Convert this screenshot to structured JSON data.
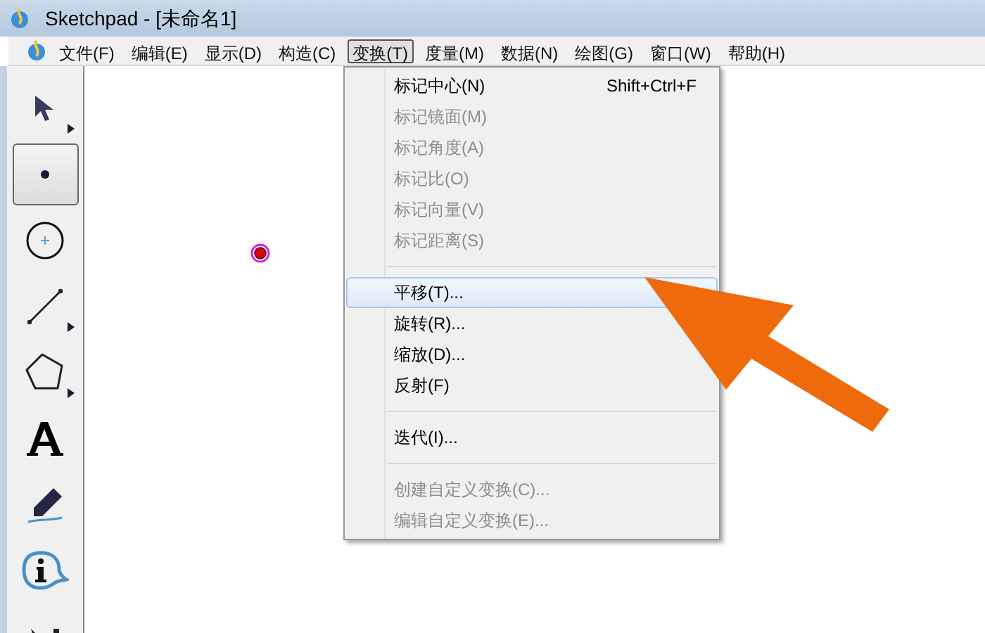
{
  "window": {
    "title": "Sketchpad  - [未命名1]"
  },
  "menubar": [
    {
      "label": "文件(F)",
      "selected": false
    },
    {
      "label": "编辑(E)",
      "selected": false
    },
    {
      "label": "显示(D)",
      "selected": false
    },
    {
      "label": "构造(C)",
      "selected": false
    },
    {
      "label": "变换(T)",
      "selected": true
    },
    {
      "label": "度量(M)",
      "selected": false
    },
    {
      "label": "数据(N)",
      "selected": false
    },
    {
      "label": "绘图(G)",
      "selected": false
    },
    {
      "label": "窗口(W)",
      "selected": false
    },
    {
      "label": "帮助(H)",
      "selected": false
    }
  ],
  "toolbox": [
    {
      "kind": "arrow",
      "selected": false,
      "submenu": true
    },
    {
      "kind": "point",
      "selected": true,
      "submenu": false
    },
    {
      "kind": "compass",
      "selected": false,
      "submenu": false
    },
    {
      "kind": "line",
      "selected": false,
      "submenu": true
    },
    {
      "kind": "polygon",
      "selected": false,
      "submenu": true
    },
    {
      "kind": "text",
      "selected": false,
      "submenu": false
    },
    {
      "kind": "marker",
      "selected": false,
      "submenu": false
    },
    {
      "kind": "info",
      "selected": false,
      "submenu": false
    },
    {
      "kind": "custom",
      "selected": false
    }
  ],
  "menu": [
    {
      "kind": "item",
      "label": "标记中心(N)",
      "shortcut": "Shift+Ctrl+F",
      "disabled": false,
      "selected": false
    },
    {
      "kind": "item",
      "label": "标记镜面(M)",
      "disabled": true,
      "selected": false
    },
    {
      "kind": "item",
      "label": "标记角度(A)",
      "disabled": true,
      "selected": false
    },
    {
      "kind": "item",
      "label": "标记比(O)",
      "disabled": true,
      "selected": false
    },
    {
      "kind": "item",
      "label": "标记向量(V)",
      "disabled": true,
      "selected": false
    },
    {
      "kind": "item",
      "label": "标记距离(S)",
      "disabled": true,
      "selected": false
    },
    {
      "kind": "separator"
    },
    {
      "kind": "item",
      "label": "平移(T)...",
      "disabled": false,
      "selected": true
    },
    {
      "kind": "item",
      "label": "旋转(R)...",
      "disabled": false,
      "selected": false
    },
    {
      "kind": "item",
      "label": "缩放(D)...",
      "disabled": false,
      "selected": false
    },
    {
      "kind": "item",
      "label": "反射(F)",
      "disabled": false,
      "selected": false
    },
    {
      "kind": "separator"
    },
    {
      "kind": "item",
      "label": "迭代(I)...",
      "disabled": false,
      "selected": false
    },
    {
      "kind": "separator"
    },
    {
      "kind": "item",
      "label": "创建自定义变换(C)...",
      "disabled": true,
      "selected": false
    },
    {
      "kind": "item",
      "label": "编辑自定义变换(E)...",
      "disabled": true,
      "selected": false
    }
  ]
}
